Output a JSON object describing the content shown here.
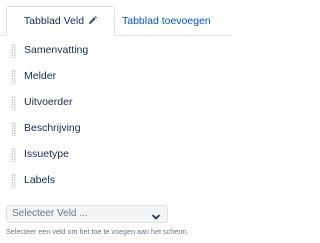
{
  "tabs": {
    "active_label": "Tabblad Veld",
    "add_label": "Tabblad toevoegen"
  },
  "fields": [
    {
      "label": "Samenvatting"
    },
    {
      "label": "Melder"
    },
    {
      "label": "Uitvoerder"
    },
    {
      "label": "Beschrijving"
    },
    {
      "label": "Issuetype"
    },
    {
      "label": "Labels"
    }
  ],
  "field_select": {
    "value": "Selecteer Veld ..."
  },
  "hint": "Selecteer een veld om het toe te voegen aan het scherm.",
  "colors": {
    "link": "#0052cc",
    "text": "#172b4d",
    "muted": "#6b778c",
    "border": "#dfe1e6"
  }
}
